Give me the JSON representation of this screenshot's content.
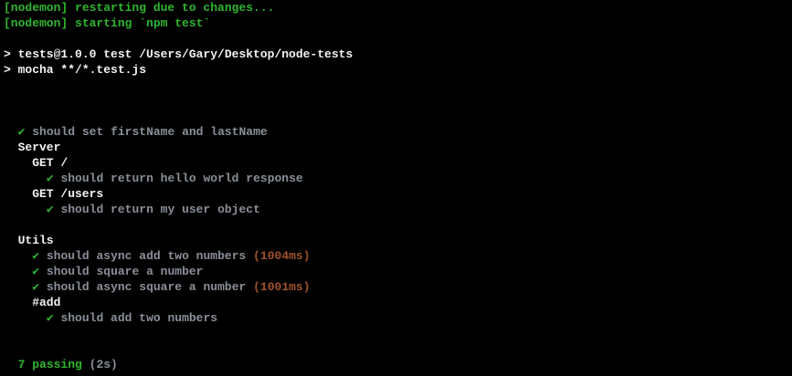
{
  "colors": {
    "green": "#2fb52f",
    "gray": "#8a8f98",
    "orange": "#a0522d",
    "white": "#f2f2f2",
    "background": "#000000"
  },
  "nodemon": {
    "restarting": "[nodemon] restarting due to changes...",
    "starting": "[nodemon] starting `npm test`"
  },
  "npm": {
    "script_line": "> tests@1.0.0 test /Users/Gary/Desktop/node-tests",
    "command_line": "> mocha **/*.test.js"
  },
  "check_icon": "✔",
  "tests": {
    "t1": "should set firstName and lastName",
    "suite_server": "Server",
    "suite_get_root": "GET /",
    "t2": "should return hello world response",
    "suite_get_users": "GET /users",
    "t3": "should return my user object",
    "suite_utils": "Utils",
    "t4": "should async add two numbers",
    "t4_duration": "(1004ms)",
    "t5": "should square a number",
    "t6": "should async square a number",
    "t6_duration": "(1001ms)",
    "suite_add": "#add",
    "t7": "should add two numbers"
  },
  "summary": {
    "passing": "7 passing",
    "duration": "(2s)"
  }
}
